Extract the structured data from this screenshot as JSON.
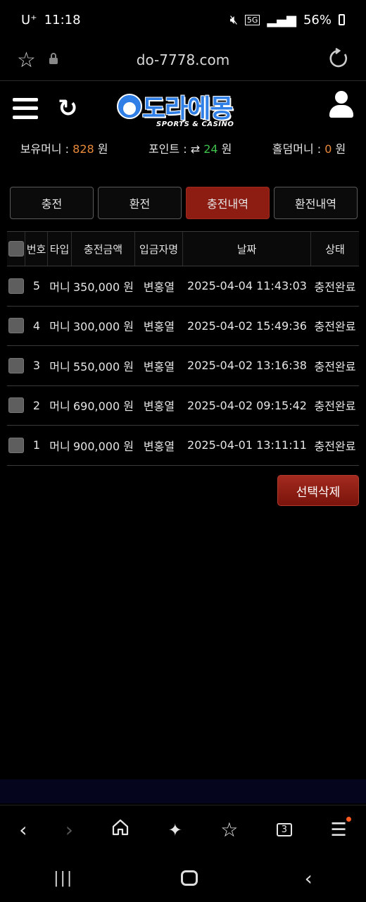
{
  "status_bar": {
    "carrier": "U⁺",
    "time": "11:18",
    "network": "5G",
    "battery": "56%"
  },
  "browser": {
    "url": "do-7778.com",
    "tab_count": "3"
  },
  "header": {
    "logo_text": "도라에몽",
    "logo_sub": "SPORTS & CASINO"
  },
  "balances": {
    "money_label": "보유머니 :",
    "money_value": "828",
    "money_unit": "원",
    "point_label": "포인트 :",
    "point_value": "24",
    "point_unit": "원",
    "holdem_label": "홀덤머니 :",
    "holdem_value": "0",
    "holdem_unit": "원",
    "value_color": "#e8893a",
    "point_color": "#3fc04a"
  },
  "tabs": [
    {
      "label": "충전",
      "active": false
    },
    {
      "label": "환전",
      "active": false
    },
    {
      "label": "충전내역",
      "active": true
    },
    {
      "label": "환전내역",
      "active": false
    }
  ],
  "table": {
    "columns": [
      "번호",
      "타입",
      "충전금액",
      "입금자명",
      "날짜",
      "상태"
    ],
    "rows": [
      {
        "no": "5",
        "type": "머니",
        "amount": "350,000 원",
        "name": "변홍열",
        "date": "2025-04-04 11:43:03",
        "status": "충전완료"
      },
      {
        "no": "4",
        "type": "머니",
        "amount": "300,000 원",
        "name": "변홍열",
        "date": "2025-04-02 15:49:36",
        "status": "충전완료"
      },
      {
        "no": "3",
        "type": "머니",
        "amount": "550,000 원",
        "name": "변홍열",
        "date": "2025-04-02 13:16:38",
        "status": "충전완료"
      },
      {
        "no": "2",
        "type": "머니",
        "amount": "690,000 원",
        "name": "변홍열",
        "date": "2025-04-02 09:15:42",
        "status": "충전완료"
      },
      {
        "no": "1",
        "type": "머니",
        "amount": "900,000 원",
        "name": "변홍열",
        "date": "2025-04-01 13:11:11",
        "status": "충전완료"
      }
    ]
  },
  "actions": {
    "delete_selected": "선택삭제"
  },
  "colors": {
    "accent_red": "#8d1c12",
    "brand_blue": "#2f7fe6"
  }
}
